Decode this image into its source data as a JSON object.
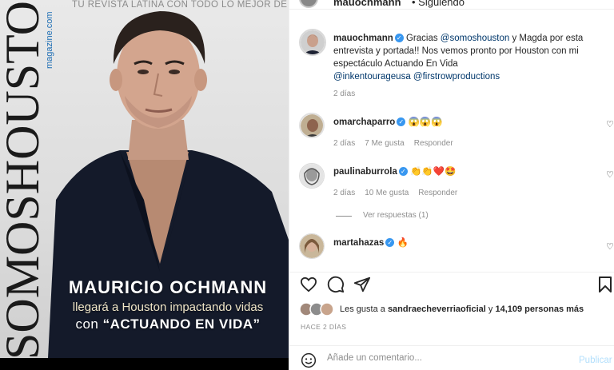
{
  "cover": {
    "brand": "SOMOSHOUSTON",
    "brand_sub": "magazine.com",
    "tagline": "TU REVISTA LATINA CON TODO LO MEJOR DE HOUSTON",
    "name": "MAURICIO OCHMANN",
    "line2": "llegará a Houston impactando vidas",
    "line3_prefix": "con ",
    "line3_bold": "“ACTUANDO EN VIDA”"
  },
  "header": {
    "username": "mauochmann",
    "follow_status": "• Siguiendo"
  },
  "caption": {
    "username": "mauochmann",
    "text_pre": "Gracias ",
    "mention1": "@somoshouston",
    "text_mid": " y Magda por esta entrevista y portada!! Nos vemos pronto por Houston con mi espectáculo Actuando En Vida ",
    "mention2": "@inkentourageusa",
    "mention3": "@firstrowproductions",
    "time": "2 días"
  },
  "comments": [
    {
      "username": "omarchaparro",
      "text": "😱😱😱",
      "time": "2 días",
      "likes": "7 Me gusta",
      "reply": "Responder"
    },
    {
      "username": "paulinaburrola",
      "text": "👏👏❤️🤩",
      "time": "2 días",
      "likes": "10 Me gusta",
      "reply": "Responder",
      "view_replies": "Ver respuestas (1)"
    },
    {
      "username": "martahazas",
      "text": "🔥"
    }
  ],
  "likes": {
    "prefix": "Les gusta a ",
    "user": "sandraecheverriaoficial",
    "mid": " y ",
    "count": "14,109 personas más"
  },
  "posted": "HACE 2 DÍAS",
  "comment_box": {
    "placeholder": "Añade un comentario...",
    "publish": "Publicar"
  },
  "icons": [
    "heart-icon",
    "comment-icon",
    "share-icon",
    "bookmark-icon",
    "emoji-icon"
  ]
}
